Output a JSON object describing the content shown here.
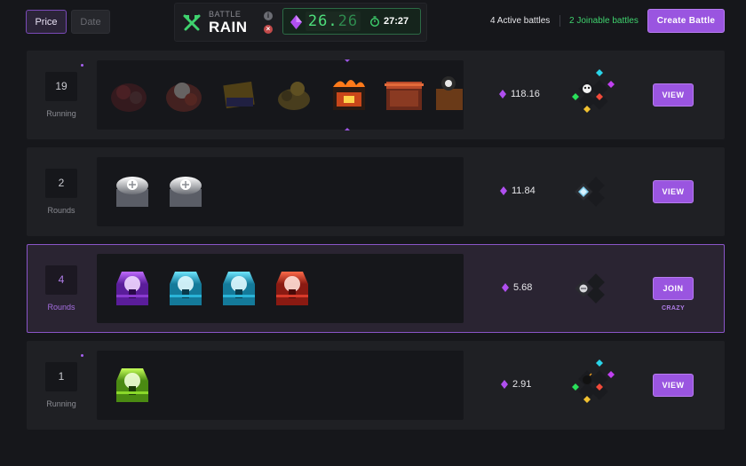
{
  "sort": {
    "price_label": "Price",
    "date_label": "Date",
    "active": "Price"
  },
  "rain": {
    "small_label": "BATTLE",
    "big_label": "RAIN",
    "info_glyph": "i",
    "close_glyph": "×",
    "amount_main": "26.",
    "amount_decimal": "26",
    "timer": "27:27",
    "accent": "#4ee07c"
  },
  "header": {
    "active_battles": "4 Active battles",
    "joinable_battles": "2 Joinable battles",
    "create_button": "Create Battle",
    "accent": "#9a55e0"
  },
  "battles": [
    {
      "count": "19",
      "status": "Running",
      "price": "118.16",
      "action": "VIEW",
      "mode": "",
      "player_icon": "skull-icon",
      "cases": [
        "dark-case-1-icon",
        "dark-case-2-icon",
        "dark-case-3-icon",
        "dark-case-4-icon",
        "fire-case-icon",
        "red-box-case-icon",
        "partial-case-icon"
      ]
    },
    {
      "count": "2",
      "status": "Rounds",
      "price": "11.84",
      "action": "VIEW",
      "mode": "",
      "player_icon": "gem-avatar-icon",
      "cases": [
        "silver-case-icon",
        "silver-case-icon"
      ]
    },
    {
      "count": "4",
      "status": "Rounds",
      "price": "5.68",
      "action": "JOIN",
      "mode": "CRAZY",
      "player_icon": "avatar-icon",
      "cases": [
        "purple-chest-icon",
        "cyan-chest-icon",
        "cyan-chest-icon",
        "red-chest-icon"
      ]
    },
    {
      "count": "1",
      "status": "Running",
      "price": "2.91",
      "action": "VIEW",
      "mode": "",
      "player_icon": "bomb-icon",
      "cases": [
        "green-chest-icon"
      ]
    }
  ]
}
